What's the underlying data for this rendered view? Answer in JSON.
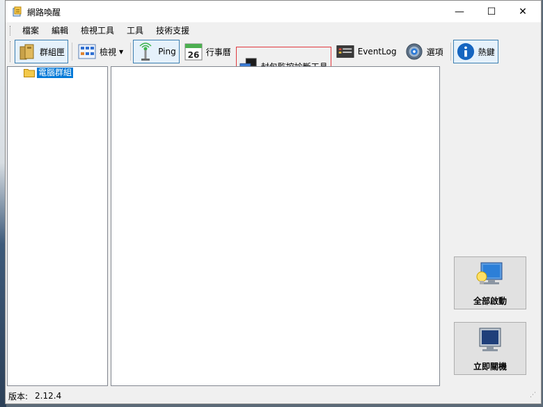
{
  "window": {
    "title": "網路喚醒"
  },
  "controls": {
    "minimize": "—",
    "maximize": "☐",
    "close": "✕"
  },
  "menu": [
    "檔案",
    "編輯",
    "檢視工具",
    "工具",
    "技術支援"
  ],
  "toolbar": {
    "group_box": "群組匣",
    "view": "檢視",
    "ping": "Ping",
    "calendar": "行事曆",
    "calendar_day": "26",
    "packet_monitor": "封包監控診斷工具",
    "eventlog": "EventLog",
    "options": "選項",
    "hotkeys": "熱鍵"
  },
  "tree": {
    "root_label": "電腦群組"
  },
  "actions": {
    "wake_all": "全部啟動",
    "shutdown_now": "立即關機"
  },
  "status": {
    "version_label": "版本:",
    "version_value": "2.12.4"
  },
  "colors": {
    "accent": "#0078d7",
    "highlight_border": "#e0393e"
  }
}
